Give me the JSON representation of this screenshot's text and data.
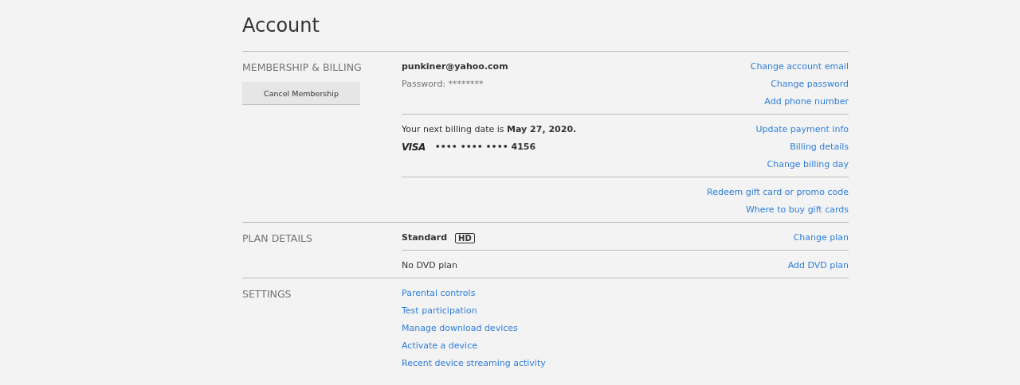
{
  "title": "Account",
  "sections": [
    {
      "label": "MEMBERSHIP & BILLING",
      "button": "Cancel Membership",
      "blocks": [
        {
          "lines": [
            {
              "kind": "email",
              "text": "punkiner@yahoo.com"
            },
            {
              "kind": "muted",
              "text": "Password: ********"
            }
          ],
          "links": [
            "Change account email",
            "Change password",
            "Add phone number"
          ]
        },
        {
          "lines": [
            {
              "kind": "billing",
              "text": "Your next billing date is **May 27, 2020.**"
            },
            {
              "kind": "card",
              "brand": "VISA",
              "number": "•••• •••• •••• 4156"
            }
          ],
          "links": [
            "Update payment info",
            "Billing details",
            "Change billing day"
          ]
        },
        {
          "links": [
            "Redeem gift card or promo code",
            "Where to buy gift cards"
          ]
        }
      ]
    },
    {
      "label": "PLAN DETAILS",
      "blocks": [
        {
          "lines": [
            {
              "kind": "plan",
              "text": "Standard",
              "badge": "HD"
            }
          ],
          "links": [
            "Change plan"
          ]
        },
        {
          "lines": [
            {
              "kind": "plain",
              "text": "No DVD plan"
            }
          ],
          "links": [
            "Add DVD plan"
          ]
        }
      ]
    },
    {
      "label": "SETTINGS",
      "blocks": [
        {
          "lines": [
            {
              "kind": "link",
              "text": "Parental controls"
            },
            {
              "kind": "link",
              "text": "Test participation"
            },
            {
              "kind": "link",
              "text": "Manage download devices"
            },
            {
              "kind": "link",
              "text": "Activate a device"
            },
            {
              "kind": "link",
              "text": "Recent device streaming activity"
            }
          ]
        }
      ]
    }
  ]
}
